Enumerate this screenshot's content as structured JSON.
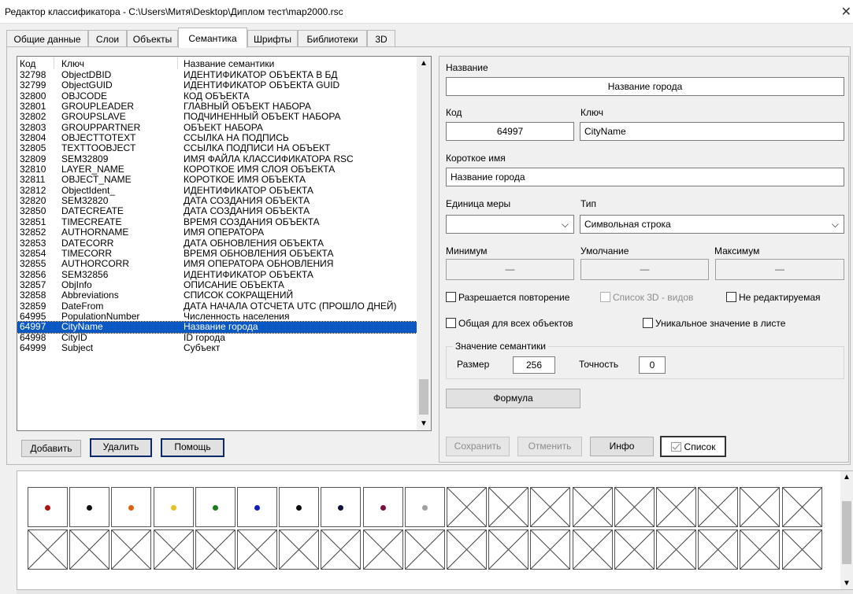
{
  "window": {
    "title": "Редактор классификатора - C:\\Users\\Митя\\Desktop\\Диплом тест\\map2000.rsc",
    "close_glyph": "✕"
  },
  "tabs": [
    {
      "label": "Общие данные"
    },
    {
      "label": "Слои"
    },
    {
      "label": "Объекты"
    },
    {
      "label": "Семантика"
    },
    {
      "label": "Шрифты"
    },
    {
      "label": "Библиотеки"
    },
    {
      "label": "3D"
    }
  ],
  "active_tab": "Семантика",
  "list": {
    "columns": [
      "Код",
      "Ключ",
      "Название семантики"
    ],
    "selected_code": "64997",
    "rows": [
      [
        "32798",
        "ObjectDBID",
        "ИДЕНТИФИКАТОР ОБЪЕКТА В БД"
      ],
      [
        "32799",
        "ObjectGUID",
        "ИДЕНТИФИКАТОР ОБЪЕКТА GUID"
      ],
      [
        "32800",
        "OBJCODE",
        "КОД ОБЪЕКТА"
      ],
      [
        "32801",
        "GROUPLEADER",
        "ГЛАВНЫЙ ОБЪЕКТ НАБОРА"
      ],
      [
        "32802",
        "GROUPSLAVE",
        "ПОДЧИНЕННЫЙ ОБЪЕКТ НАБОРА"
      ],
      [
        "32803",
        "GROUPPARTNER",
        "ОБЪЕКТ НАБОРА"
      ],
      [
        "32804",
        "OBJECTTOTEXT",
        "ССЫЛКА НА ПОДПИСЬ"
      ],
      [
        "32805",
        "TEXTTOOBJECT",
        "ССЫЛКА ПОДПИСИ НА ОБЪЕКТ"
      ],
      [
        "32809",
        "SEM32809",
        "ИМЯ ФАЙЛА КЛАССИФИКАТОРА RSC"
      ],
      [
        "32810",
        "LAYER_NAME",
        "КОРОТКОЕ ИМЯ СЛОЯ ОБЪЕКТА"
      ],
      [
        "32811",
        "OBJECT_NAME",
        "КОРОТКОЕ ИМЯ ОБЪЕКТА"
      ],
      [
        "32812",
        "ObjectIdent_",
        "ИДЕНТИФИКАТОР ОБЪЕКТА"
      ],
      [
        "32820",
        "SEM32820",
        "ДАТА СОЗДАНИЯ ОБЪЕКТА"
      ],
      [
        "32850",
        "DATECREATE",
        "ДАТА СОЗДАНИЯ ОБЪЕКТА"
      ],
      [
        "32851",
        "TIMECREATE",
        "ВРЕМЯ СОЗДАНИЯ ОБЪЕКТА"
      ],
      [
        "32852",
        "AUTHORNAME",
        "ИМЯ ОПЕРАТОРА"
      ],
      [
        "32853",
        "DATECORR",
        "ДАТА ОБНОВЛЕНИЯ ОБЪЕКТА"
      ],
      [
        "32854",
        "TIMECORR",
        "ВРЕМЯ ОБНОВЛЕНИЯ ОБЪЕКТА"
      ],
      [
        "32855",
        "AUTHORCORR",
        "ИМЯ ОПЕРАТОРА ОБНОВЛЕНИЯ"
      ],
      [
        "32856",
        "SEM32856",
        "ИДЕНТИФИКАТОР ОБЪЕКТА"
      ],
      [
        "32857",
        "ObjInfo",
        "ОПИСАНИЕ ОБЪЕКТА"
      ],
      [
        "32858",
        "Abbreviations",
        "СПИСОК СОКРАЩЕНИЙ"
      ],
      [
        "32859",
        "DateFrom",
        "ДАТА НАЧАЛА ОТСЧЕТА UTC (ПРОШЛО ДНЕЙ)"
      ],
      [
        "64995",
        "PopulationNumber",
        "Численность населения"
      ],
      [
        "64997",
        "CityName",
        "Название города"
      ],
      [
        "64998",
        "CityID",
        "ID города"
      ],
      [
        "64999",
        "Subject",
        "Субъект"
      ]
    ],
    "scroll_up": "▲",
    "scroll_down": "▼"
  },
  "list_buttons": {
    "add": "Добавить",
    "delete": "Удалить",
    "help": "Помощь"
  },
  "details": {
    "name_label": "Название",
    "name_value": "Название города",
    "code_label": "Код",
    "code_value": "64997",
    "key_label": "Ключ",
    "key_value": "CityName",
    "short_name_label": "Короткое имя",
    "short_name_value": "Название города",
    "unit_label": "Единица меры",
    "unit_value": "",
    "type_label": "Тип",
    "type_value": "Символьная строка",
    "min_label": "Минимум",
    "min_value": "—",
    "default_label": "Умолчание",
    "default_value": "—",
    "max_label": "Максимум",
    "max_value": "—",
    "chk_repeat": "Разрешается повторение",
    "chk_3d": "Список 3D - видов",
    "chk_readonly": "Не редактируемая",
    "chk_common": "Общая для всех объектов",
    "chk_unique": "Уникальное значение в листе",
    "value_group_title": "Значение семантики",
    "size_label": "Размер",
    "size_value": "256",
    "precision_label": "Точность",
    "precision_value": "0",
    "formula_button": "Формула",
    "dropdown_glyph": "⌵"
  },
  "detail_buttons": {
    "save": "Сохранить",
    "cancel": "Отменить",
    "info": "Инфо",
    "list": "Список"
  },
  "palette": {
    "dot_colors": [
      "#b01010",
      "#111111",
      "#e06010",
      "#e8c020",
      "#1a7a1a",
      "#1020c0",
      "#0a0a0a",
      "#101040",
      "#7a1040",
      "#a0a0a0"
    ],
    "empty_cells_row1": 9,
    "empty_cells_row2": 19
  }
}
